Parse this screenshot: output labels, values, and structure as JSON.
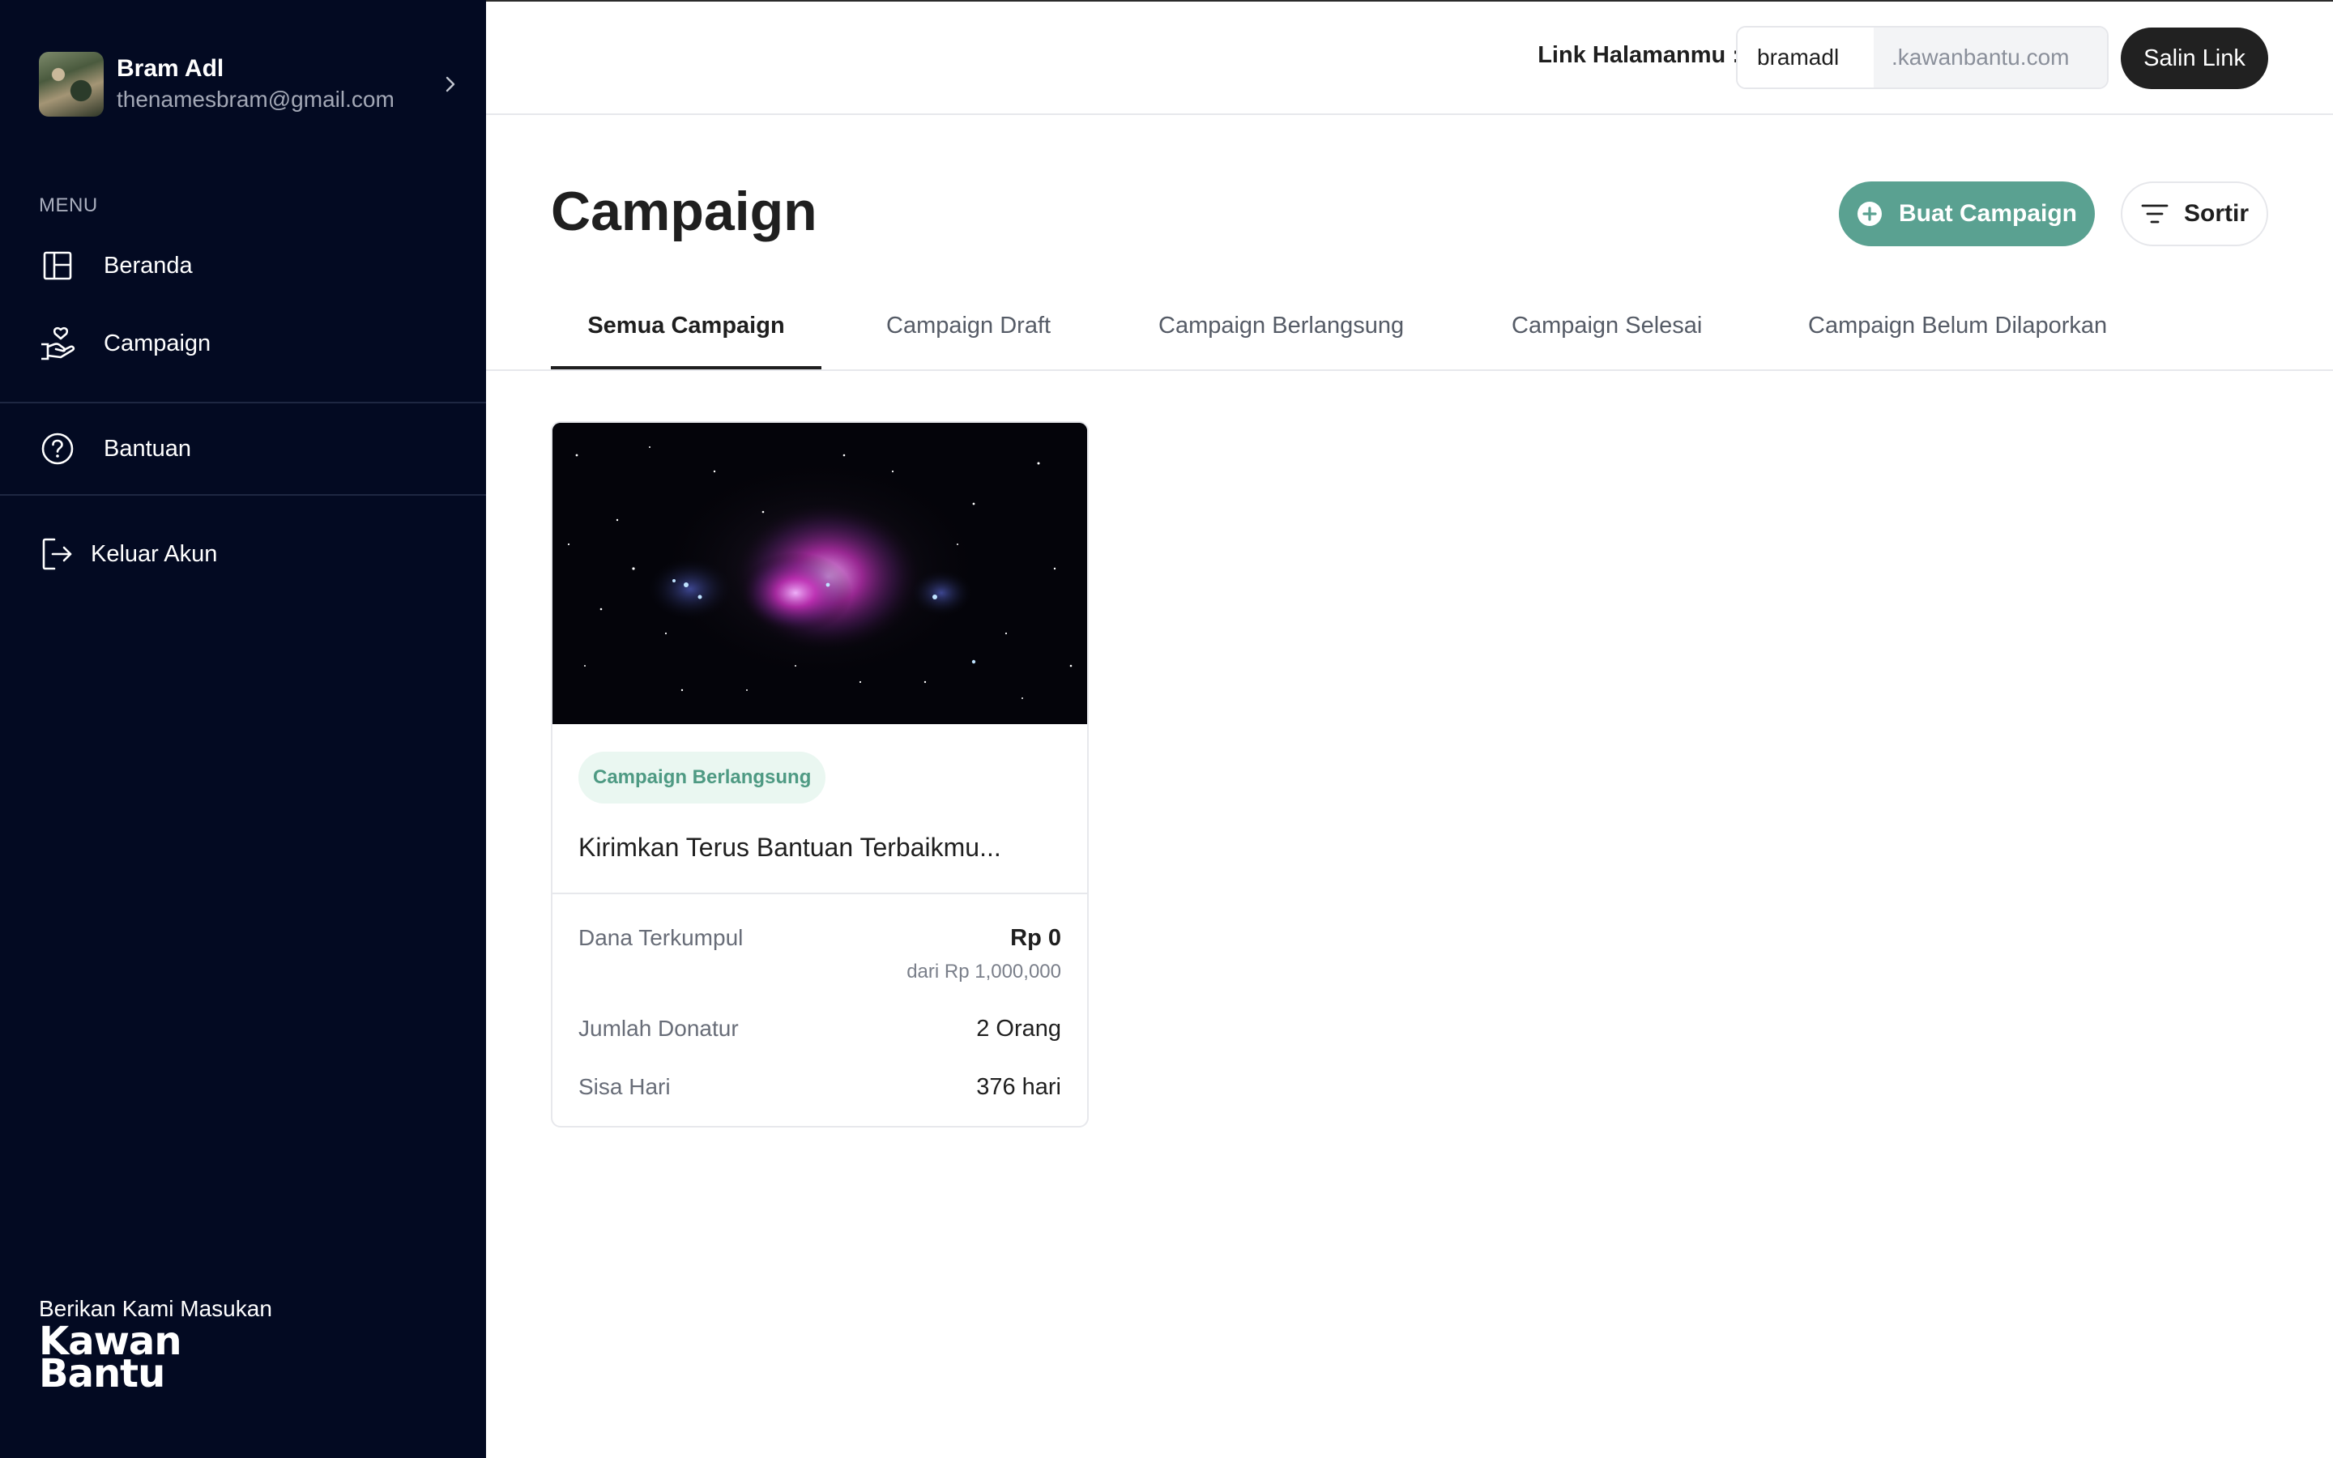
{
  "user": {
    "name": "Bram Adl",
    "email": "thenamesbram@gmail.com"
  },
  "sidebar": {
    "menu_label": "MENU",
    "items": [
      {
        "label": "Beranda",
        "icon": "layout-icon"
      },
      {
        "label": "Campaign",
        "icon": "hand-heart-icon"
      },
      {
        "label": "Bantuan",
        "icon": "help-circle-icon"
      },
      {
        "label": "Keluar Akun",
        "icon": "logout-icon"
      }
    ],
    "feedback": "Berikan Kami Masukan",
    "logo_line1": "Kawan",
    "logo_line2": "Bantu"
  },
  "topbar": {
    "link_label": "Link Halamanmu :",
    "username": "bramadl",
    "domain": ".kawanbantu.com",
    "copy_label": "Salin Link"
  },
  "page": {
    "title": "Campaign",
    "create_label": "Buat Campaign",
    "sort_label": "Sortir"
  },
  "tabs": [
    {
      "label": "Semua Campaign",
      "active": true
    },
    {
      "label": "Campaign Draft",
      "active": false
    },
    {
      "label": "Campaign Berlangsung",
      "active": false
    },
    {
      "label": "Campaign Selesai",
      "active": false
    },
    {
      "label": "Campaign Belum Dilaporkan",
      "active": false
    }
  ],
  "card": {
    "status": "Campaign Berlangsung",
    "title": "Kirimkan Terus Bantuan Terbaikmu...",
    "raised_label": "Dana Terkumpul",
    "raised_value": "Rp 0",
    "target": "dari Rp 1,000,000",
    "donors_label": "Jumlah Donatur",
    "donors_value": "2 Orang",
    "days_label": "Sisa Hari",
    "days_value": "376 hari"
  },
  "colors": {
    "sidebar_bg": "#030a22",
    "accent": "#5aa191",
    "badge_bg": "#eaf7f1",
    "dark_button": "#212121"
  }
}
